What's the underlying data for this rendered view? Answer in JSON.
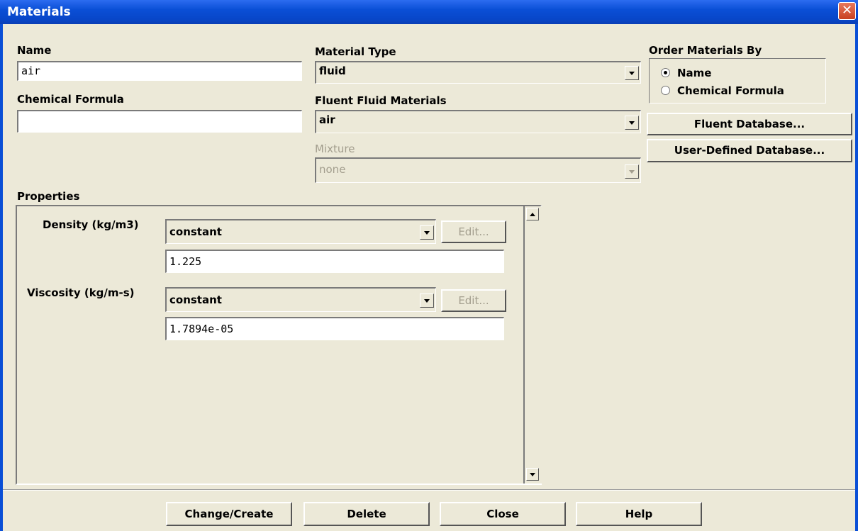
{
  "window": {
    "title": "Materials",
    "close_glyph": "✕"
  },
  "name": {
    "label": "Name",
    "value": "air"
  },
  "chemical_formula": {
    "label": "Chemical Formula",
    "value": ""
  },
  "material_type": {
    "label": "Material Type",
    "value": "fluid"
  },
  "fluent_fluid_materials": {
    "label": "Fluent Fluid Materials",
    "value": "air"
  },
  "mixture": {
    "label": "Mixture",
    "value": "none"
  },
  "order_by": {
    "label": "Order Materials By",
    "options": [
      {
        "label": "Name",
        "selected": true
      },
      {
        "label": "Chemical Formula",
        "selected": false
      }
    ]
  },
  "buttons": {
    "fluent_database": "Fluent Database...",
    "user_defined_database": "User-Defined Database..."
  },
  "properties": {
    "label": "Properties",
    "density": {
      "label": "Density (kg/m3)",
      "method": "constant",
      "edit": "Edit...",
      "value": "1.225"
    },
    "viscosity": {
      "label": "Viscosity (kg/m-s)",
      "method": "constant",
      "edit": "Edit...",
      "value": "1.7894e-05"
    }
  },
  "footer": {
    "change_create": "Change/Create",
    "delete": "Delete",
    "close": "Close",
    "help": "Help"
  }
}
